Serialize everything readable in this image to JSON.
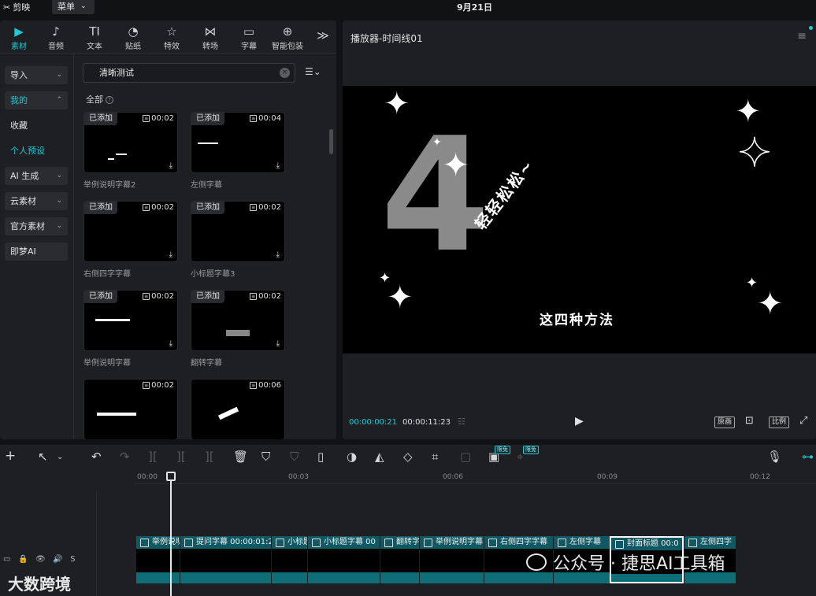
{
  "titlebar": {
    "app_name": "剪映",
    "menu_label": "菜单",
    "date": "9月21日"
  },
  "toolbar": {
    "tabs": [
      {
        "label": "素材",
        "icon": "media-icon"
      },
      {
        "label": "音频",
        "icon": "audio-icon"
      },
      {
        "label": "文本",
        "icon": "text-icon",
        "glyph": "TI"
      },
      {
        "label": "贴纸",
        "icon": "sticker-icon"
      },
      {
        "label": "特效",
        "icon": "effects-icon"
      },
      {
        "label": "转场",
        "icon": "transition-icon"
      },
      {
        "label": "字幕",
        "icon": "subtitle-icon"
      },
      {
        "label": "智能包装",
        "icon": "smart-package-icon"
      }
    ],
    "more": "≫"
  },
  "sidebar": {
    "items": [
      {
        "label": "导入"
      },
      {
        "label": "我的"
      },
      {
        "label": "收藏"
      },
      {
        "label": "个人预设"
      },
      {
        "label": "AI 生成"
      },
      {
        "label": "云素材"
      },
      {
        "label": "官方素材"
      },
      {
        "label": "即梦AI"
      }
    ]
  },
  "search": {
    "value": "清晰测试"
  },
  "filter": {
    "label": "全部"
  },
  "cards": [
    {
      "badge": "已添加",
      "duration": "00:02",
      "name": "举例说明字幕2"
    },
    {
      "badge": "已添加",
      "duration": "00:04",
      "name": "左侧字幕"
    },
    {
      "badge": "已添加",
      "duration": "00:02",
      "name": "右侧四字字幕"
    },
    {
      "badge": "已添加",
      "duration": "00:02",
      "name": "小标题字幕3"
    },
    {
      "badge": "已添加",
      "duration": "00:02",
      "name": "举例说明字幕"
    },
    {
      "badge": "已添加",
      "duration": "00:02",
      "name": "翻转字幕"
    },
    {
      "badge": "",
      "duration": "00:02",
      "name": ""
    },
    {
      "badge": "",
      "duration": "00:06",
      "name": ""
    }
  ],
  "preview": {
    "title": "播放器-时间线01",
    "big_number": "4",
    "curved_text": "轻轻松松~",
    "subtitle": "这四种方法",
    "time_current": "00:00:00:21",
    "time_total": "00:00:11:23",
    "btn_original": "原画",
    "btn_ratio": "比例"
  },
  "timeline": {
    "ticks": [
      "00:00",
      "00:03",
      "00:06",
      "00:09",
      "00:12"
    ],
    "free_badge": "限免",
    "track_s": "S",
    "clips": [
      {
        "label": "举例说明"
      },
      {
        "label": "提问字幕  00:00:01:2"
      },
      {
        "label": "小标题"
      },
      {
        "label": "小标题字幕  00"
      },
      {
        "label": "翻转字"
      },
      {
        "label": "举例说明字幕"
      },
      {
        "label": "右侧四字字幕"
      },
      {
        "label": "左侧字幕"
      },
      {
        "label": "封面标题  00:0"
      },
      {
        "label": "左侧四字"
      }
    ]
  },
  "watermarks": {
    "wechat": "公众号 · 捷思AI工具箱",
    "brand": "大数跨境"
  },
  "colors": {
    "accent": "#22c7d2",
    "panel": "#1e1f22",
    "clip": "#0f5964"
  }
}
